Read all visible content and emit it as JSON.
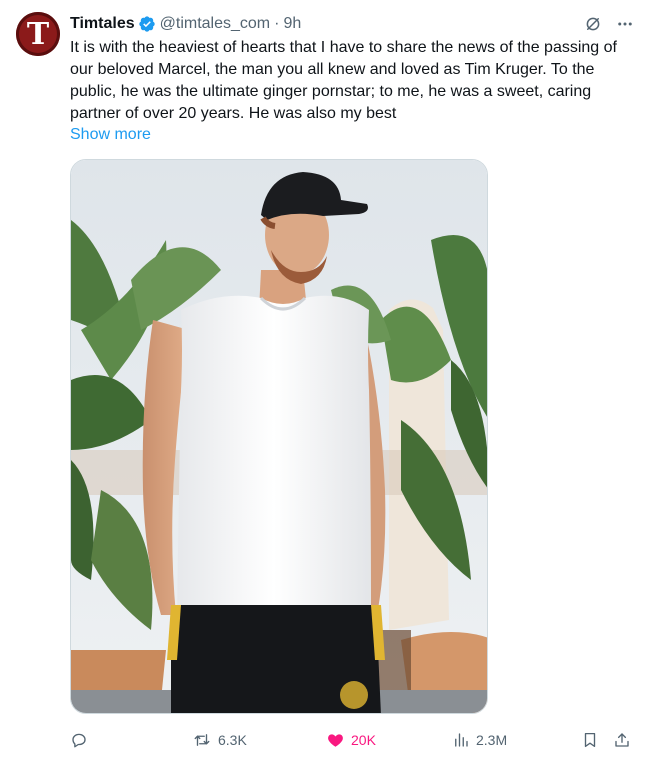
{
  "tweet": {
    "author_name": "Timtales",
    "avatar_letter": "T",
    "handle": "@timtales_com",
    "separator": "·",
    "time": "9h",
    "text": "It is with the heaviest of hearts that I have to share the news of the passing of our beloved Marcel, the man you all knew and loved as Tim Kruger. To the public, he was the ultimate ginger pornstar; to me, he was a sweet, caring partner of over 20 years. He was also my best",
    "show_more": "Show more"
  },
  "stats": {
    "retweets": "6.3K",
    "likes": "20K",
    "views": "2.3M"
  },
  "colors": {
    "accent": "#1d9bf0",
    "like": "#f91880",
    "muted": "#536471",
    "avatar_bg": "#8b1a1a"
  },
  "icons": [
    "verified-badge-icon",
    "grok-icon",
    "more-icon",
    "reply-icon",
    "retweet-icon",
    "heart-icon",
    "views-icon",
    "bookmark-icon",
    "share-icon"
  ]
}
